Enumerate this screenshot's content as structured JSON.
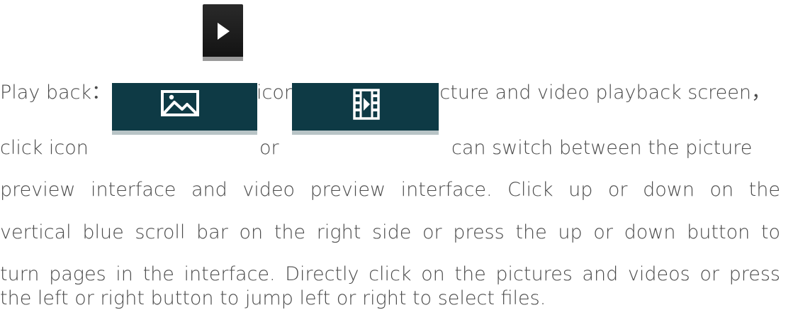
{
  "paragraph": {
    "line1_a": "Play back：  click",
    "line1_b": "icon enter to the picture and video playback screen，",
    "line2_a": "click icon",
    "line2_or": "or",
    "line2_b": "can switch between the picture",
    "line3": "preview interface and video preview interface. Click up or down on the",
    "line4": "vertical blue scroll bar on the right side or press the up or down button to",
    "line5": "turn pages in the interface. Directly click on the pictures and videos or press",
    "line6": "the left or right button to jump left or right to select files."
  },
  "icons": {
    "playback": "play-icon",
    "picture": "picture-icon",
    "video": "video-icon"
  }
}
